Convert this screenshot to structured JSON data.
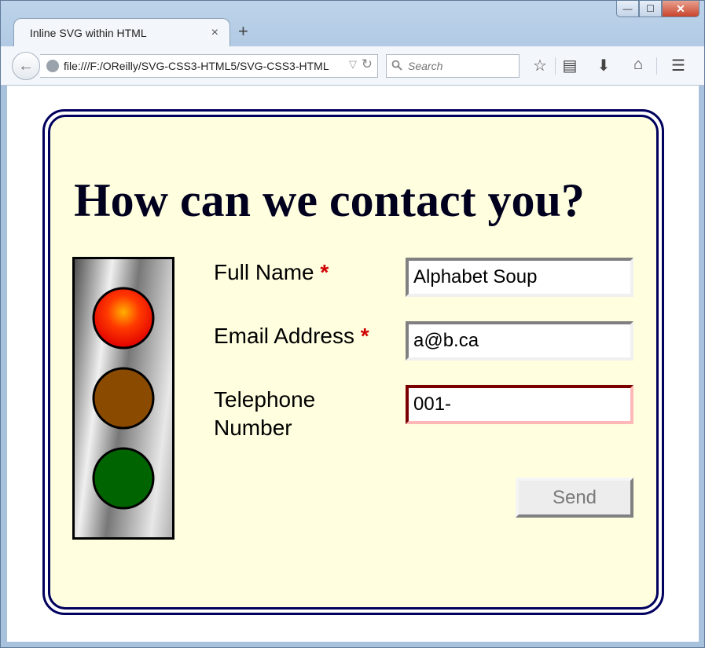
{
  "window": {
    "tab_title": "Inline SVG within HTML",
    "tab_close": "×",
    "new_tab": "+",
    "minimize": "—",
    "maximize": "☐",
    "close": "✕"
  },
  "navbar": {
    "back": "←",
    "url": "file:///F:/OReilly/SVG-CSS3-HTML5/SVG-CSS3-HTML",
    "url_dropdown": "▽",
    "reload": "↻",
    "search_placeholder": "Search",
    "bookmark": "☆",
    "reading_list": "▤",
    "downloads": "⬇",
    "home": "⌂",
    "menu": "☰"
  },
  "page": {
    "heading": "How can we contact you?",
    "form": {
      "full_name_label": "Full Name",
      "email_label": "Email Address",
      "phone_label_line1": "Telephone",
      "phone_label_line2": "Number",
      "required_marker": "*",
      "full_name_value": "Alphabet Soup",
      "email_value": "a@b.ca",
      "phone_value": "001-",
      "send_label": "Send"
    },
    "traffic_light": {
      "red": "#ff2a00",
      "amber": "#8a4b00",
      "green": "#006400"
    }
  }
}
